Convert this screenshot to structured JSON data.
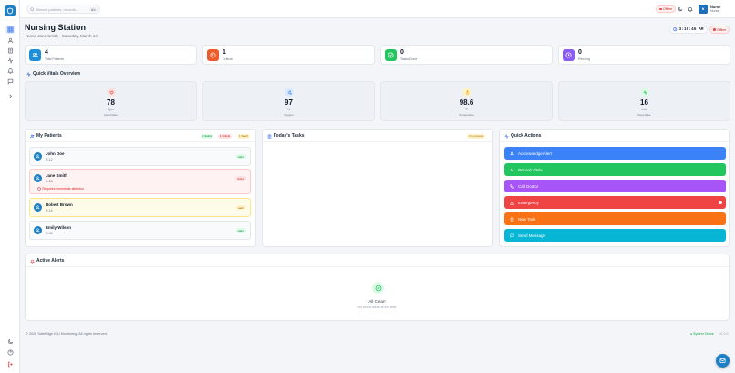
{
  "colors": {
    "brand": "#1d7fc4",
    "critical": "#ef4444",
    "success": "#22c55e",
    "warning": "#f59e0b"
  },
  "topbar": {
    "search_placeholder": "Search patients, records...",
    "search_shortcut": "⌘K",
    "status": "Offline",
    "user": {
      "initials": "N",
      "name": "Nurse",
      "role": "Nurse"
    }
  },
  "header": {
    "title": "Nursing Station",
    "subtitle": "Nurse Jane Smith - Saturday, March 14",
    "clock": "3:16:46 AM",
    "status": "Offline"
  },
  "stats": [
    {
      "value": "4",
      "label": "Total Patients",
      "icon": "users-icon",
      "color": "#1d8fd8"
    },
    {
      "value": "1",
      "label": "Critical",
      "icon": "alert-circle-icon",
      "color": "#ef5a2a"
    },
    {
      "value": "0",
      "label": "Tasks Done",
      "icon": "check-circle-icon",
      "color": "#22c55e"
    },
    {
      "value": "0",
      "label": "Pending",
      "icon": "clock-icon",
      "color": "#8b5cf6"
    }
  ],
  "vitals": {
    "title": "Quick Vitals Overview",
    "items": [
      {
        "value": "78",
        "unit": "bpm",
        "label": "Heart Rate",
        "icon": "heart-icon",
        "color": "#ef4444",
        "bg": "#fee2e2"
      },
      {
        "value": "97",
        "unit": "%",
        "label": "Oxygen",
        "icon": "wind-icon",
        "color": "#3b82f6",
        "bg": "#dbeafe"
      },
      {
        "value": "98.6",
        "unit": "°F",
        "label": "Temperature",
        "icon": "thermometer-icon",
        "color": "#f59e0b",
        "bg": "#fef3c7"
      },
      {
        "value": "16",
        "unit": "/min",
        "label": "Resp Rate",
        "icon": "activity-icon",
        "color": "#22c55e",
        "bg": "#dcfce7"
      }
    ]
  },
  "patients": {
    "title": "My Patients",
    "badges": {
      "stable": "2 Stable",
      "critical": "1 Critical",
      "watch": "1 Watch"
    },
    "items": [
      {
        "name": "John Doe",
        "room": "R-12",
        "status": "stable"
      },
      {
        "name": "Jane Smith",
        "room": "R-08",
        "status": "critical",
        "warning": "Requires immediate attention"
      },
      {
        "name": "Robert Brown",
        "room": "R-15",
        "status": "watch"
      },
      {
        "name": "Emily Wilson",
        "room": "R-03",
        "status": "stable"
      }
    ]
  },
  "tasks": {
    "title": "Today's Tasks",
    "badge": "0 in progress"
  },
  "quick_actions": {
    "title": "Quick Actions",
    "items": [
      {
        "label": "Acknowledge Alert",
        "icon": "bell-icon",
        "color": "#3b82f6"
      },
      {
        "label": "Record Vitals",
        "icon": "activity-icon",
        "color": "#22c55e"
      },
      {
        "label": "Call Doctor",
        "icon": "phone-icon",
        "color": "#a855f7"
      },
      {
        "label": "Emergency",
        "icon": "alert-triangle-icon",
        "color": "#ef4444"
      },
      {
        "label": "New Task",
        "icon": "clipboard-icon",
        "color": "#f97316"
      },
      {
        "label": "Send Message",
        "icon": "message-icon",
        "color": "#06b6d4"
      }
    ]
  },
  "alerts": {
    "title": "Active Alerts",
    "empty_title": "All Clear!",
    "empty_text": "No active alerts at this time"
  },
  "footer": {
    "copyright": "© 2026 SafeEdge ICU Monitoring. All rights reserved.",
    "status": "System Online",
    "version": "v1.0.0"
  }
}
